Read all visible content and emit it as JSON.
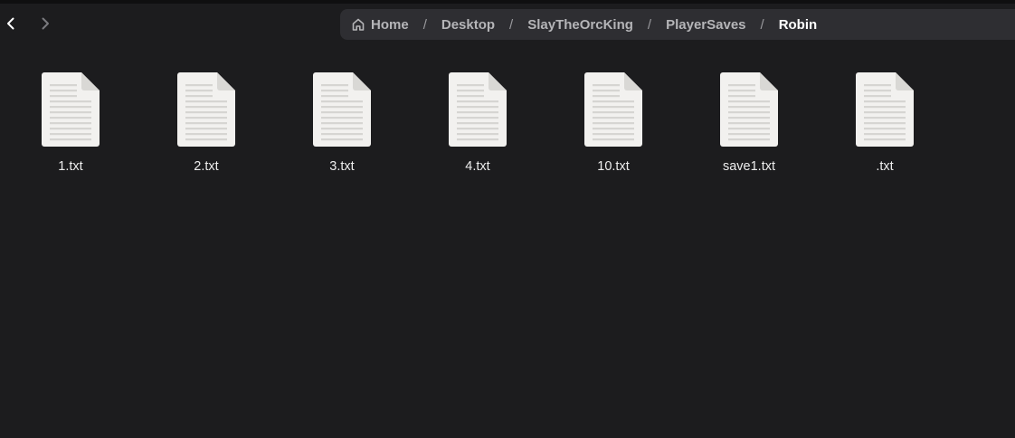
{
  "toolbar": {
    "back_icon": "chevron-left-icon",
    "forward_icon": "chevron-right-icon"
  },
  "pathbar": {
    "home_icon": "home-icon",
    "crumbs": [
      {
        "label": "Home"
      },
      {
        "label": "Desktop"
      },
      {
        "label": "SlayTheOrcKing"
      },
      {
        "label": "PlayerSaves"
      },
      {
        "label": "Robin"
      }
    ],
    "separator": "/"
  },
  "files": [
    {
      "name": "1.txt",
      "icon": "text-file-icon"
    },
    {
      "name": "2.txt",
      "icon": "text-file-icon"
    },
    {
      "name": "3.txt",
      "icon": "text-file-icon"
    },
    {
      "name": "4.txt",
      "icon": "text-file-icon"
    },
    {
      "name": "10.txt",
      "icon": "text-file-icon"
    },
    {
      "name": "save1.txt",
      "icon": "text-file-icon"
    },
    {
      "name": ".txt",
      "icon": "text-file-icon"
    }
  ],
  "colors": {
    "background": "#1c1c1e",
    "pathbar": "#2e2e32",
    "file_icon": "#f2f1ef",
    "file_lines": "#d6d5d2"
  }
}
